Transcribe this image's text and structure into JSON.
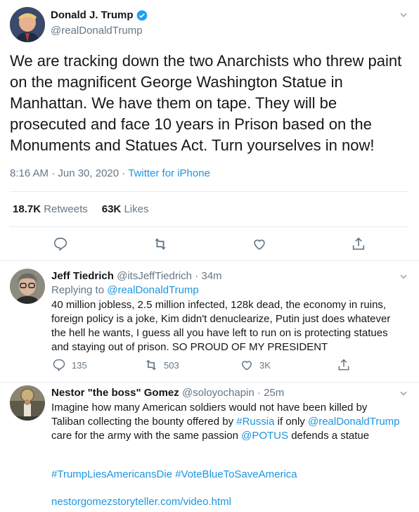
{
  "main_tweet": {
    "author_name": "Donald J. Trump",
    "author_handle": "@realDonaldTrump",
    "text": "We are tracking down the two Anarchists who threw paint on the magnificent George Washington Statue in Manhattan. We have them on tape. They will be prosecuted and face 10 years in Prison based on the Monuments and Statues Act. Turn yourselves in now!",
    "timestamp": "8:16 AM · Jun 30, 2020 ·",
    "source": "Twitter for iPhone",
    "retweets_count": "18.7K",
    "retweets_label": "Retweets",
    "likes_count": "63K",
    "likes_label": "Likes"
  },
  "replies": [
    {
      "author_name": "Jeff Tiedrich",
      "author_handle": "@itsJeffTiedrich",
      "time": "· 34m",
      "replying_to_label": "Replying to",
      "replying_to_handle": "@realDonaldTrump",
      "text": "40 million jobless, 2.5 million infected, 128k dead, the economy in ruins, foreign policy is a joke, Kim didn't denuclearize, Putin just does whatever the hell he wants, I guess all you have left to run on is protecting statues and staying out of prison. SO PROUD OF MY PRESIDENT",
      "reply_count": "135",
      "retweet_count": "503",
      "like_count": "3K"
    },
    {
      "author_name": "Nestor \"the boss\" Gomez",
      "author_handle": "@soloyochapin",
      "time": "· 25m",
      "text_1": "Imagine how many American soldiers would not have been killed by Taliban collecting the bounty offered by ",
      "mention_russia": "#Russia",
      "text_2": " if only ",
      "mention_trump": "@realDonaldTrump",
      "text_3": " care for the army with the same passion ",
      "mention_potus": "@POTUS",
      "text_4": " defends a statue",
      "hashtag_1": "#TrumpLiesAmericansDie",
      "hashtag_2": "#VoteBlueToSaveAmerica",
      "link": "nestorgomezstoryteller.com/video.html"
    }
  ],
  "colors": {
    "link_blue": "#1b95e0",
    "muted_gray": "#657786",
    "divider": "#e6ecf0"
  }
}
